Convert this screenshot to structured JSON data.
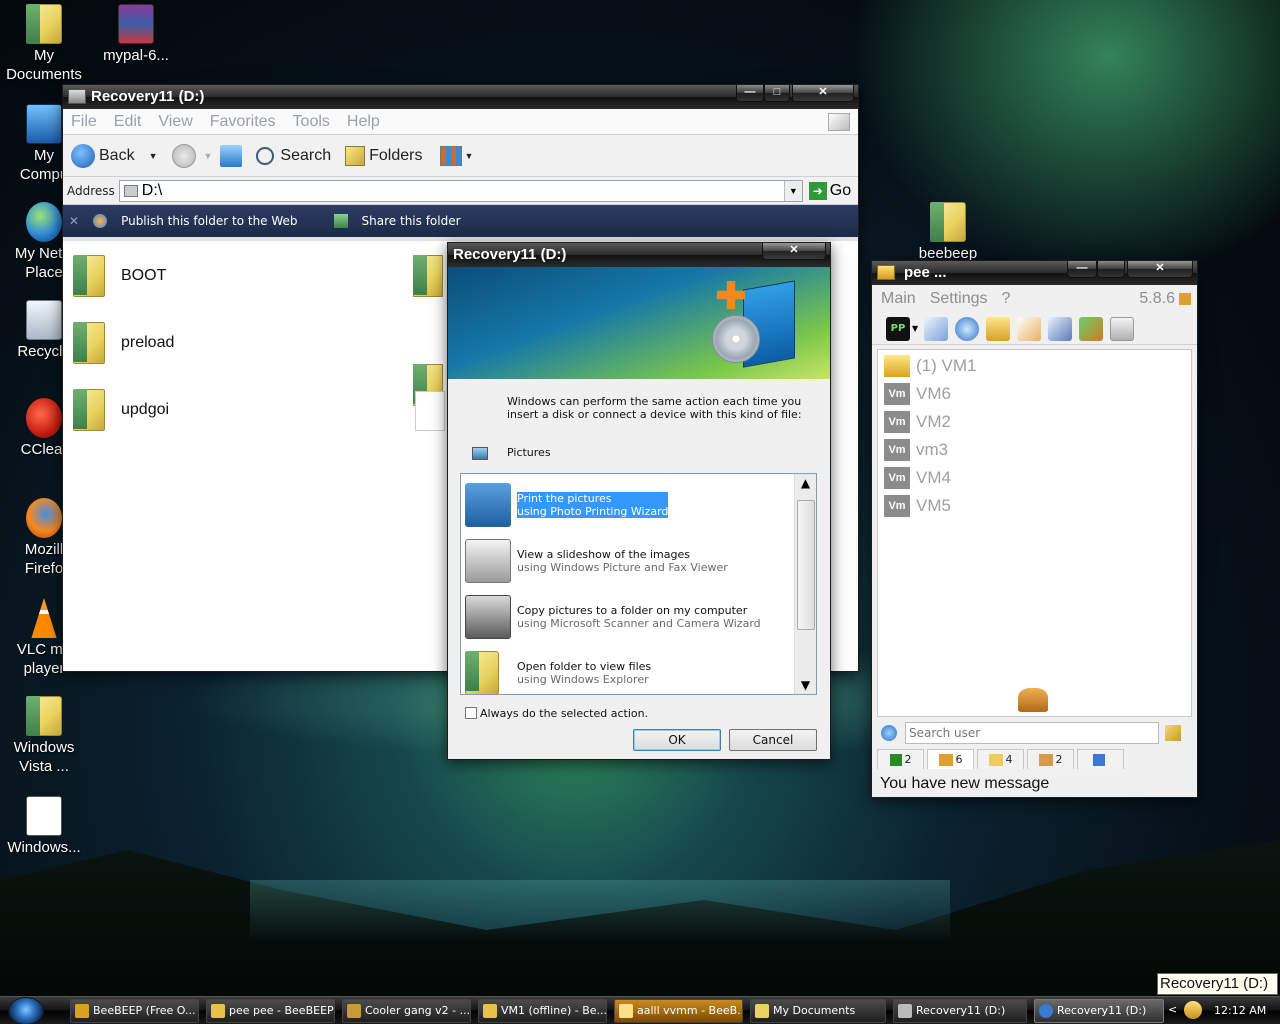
{
  "desktop": {
    "icons": [
      {
        "label": "My\nDocuments"
      },
      {
        "label": "mypal-6..."
      },
      {
        "label": "My\nCompu"
      },
      {
        "label": "My Netw\nPlace"
      },
      {
        "label": "Recycle"
      },
      {
        "label": "CClear"
      },
      {
        "label": "Mozill\nFirefo"
      },
      {
        "label": "VLC me\nplayer"
      },
      {
        "label": "Windows\nVista ..."
      },
      {
        "label": "Windows..."
      },
      {
        "label": "beebeep"
      }
    ]
  },
  "explorer": {
    "title": "Recovery11 (D:)",
    "menu": [
      "File",
      "Edit",
      "View",
      "Favorites",
      "Tools",
      "Help"
    ],
    "toolbar": {
      "back": "Back",
      "search": "Search",
      "folders": "Folders"
    },
    "address": {
      "label": "Address",
      "value": "D:\\",
      "go": "Go"
    },
    "tasks": {
      "publish": "Publish this folder to the Web",
      "share": "Share this folder"
    },
    "files": [
      {
        "name": "BOOT"
      },
      {
        "name": "preload"
      },
      {
        "name": "updgoi"
      }
    ]
  },
  "autoplay": {
    "title": "Recovery11 (D:)",
    "intro": "Windows can perform the same action each time you insert a disk or connect a device with this kind of file:",
    "filetype": "Pictures",
    "options": [
      {
        "line1": "Print the pictures",
        "line2": "using Photo Printing Wizard",
        "selected": true,
        "icon": "printer-icon"
      },
      {
        "line1": "View a slideshow of the images",
        "line2": "using Windows Picture and Fax Viewer",
        "selected": false,
        "icon": "slideshow-icon"
      },
      {
        "line1": "Copy pictures to a folder on my computer",
        "line2": "using Microsoft Scanner and Camera Wizard",
        "selected": false,
        "icon": "scanner-camera-icon"
      },
      {
        "line1": "Open folder to view files",
        "line2": "using Windows Explorer",
        "selected": false,
        "icon": "folder-icon"
      }
    ],
    "always_checkbox": "Always do the selected action.",
    "ok": "OK",
    "cancel": "Cancel"
  },
  "beebeep": {
    "title": "pee ...",
    "menu": [
      "Main",
      "Settings",
      "?"
    ],
    "version": "5.8.6",
    "pp_badge": "PP",
    "users": [
      {
        "name": "(1) VM1",
        "badge": ""
      },
      {
        "name": "VM6",
        "badge": "Vm"
      },
      {
        "name": "VM2",
        "badge": "Vm"
      },
      {
        "name": "vm3",
        "badge": "Vm"
      },
      {
        "name": "VM4",
        "badge": "Vm"
      },
      {
        "name": "VM5",
        "badge": "Vm"
      }
    ],
    "search_placeholder": "Search user",
    "tabs": [
      {
        "count": "2"
      },
      {
        "count": "6"
      },
      {
        "count": "4"
      },
      {
        "count": "2"
      },
      {
        "count": ""
      }
    ],
    "status": "You have new message"
  },
  "taskbar": {
    "tasks": [
      {
        "label": "BeeBEEP (Free O..."
      },
      {
        "label": "pee pee - BeeBEEP"
      },
      {
        "label": "Cooler gang v2 - ..."
      },
      {
        "label": "VM1 (offline) - Be..."
      },
      {
        "label": "aalll vvmm - BeeB..."
      },
      {
        "label": "My Documents"
      },
      {
        "label": "Recovery11 (D:)"
      },
      {
        "label": "Recovery11 (D:)"
      }
    ],
    "clock": "12:12 AM",
    "tooltip": "Recovery11 (D:)"
  },
  "colors": {
    "selection": "#3399ff",
    "titlebar_dark": "#111111",
    "task_strip": "#2c3c63"
  }
}
